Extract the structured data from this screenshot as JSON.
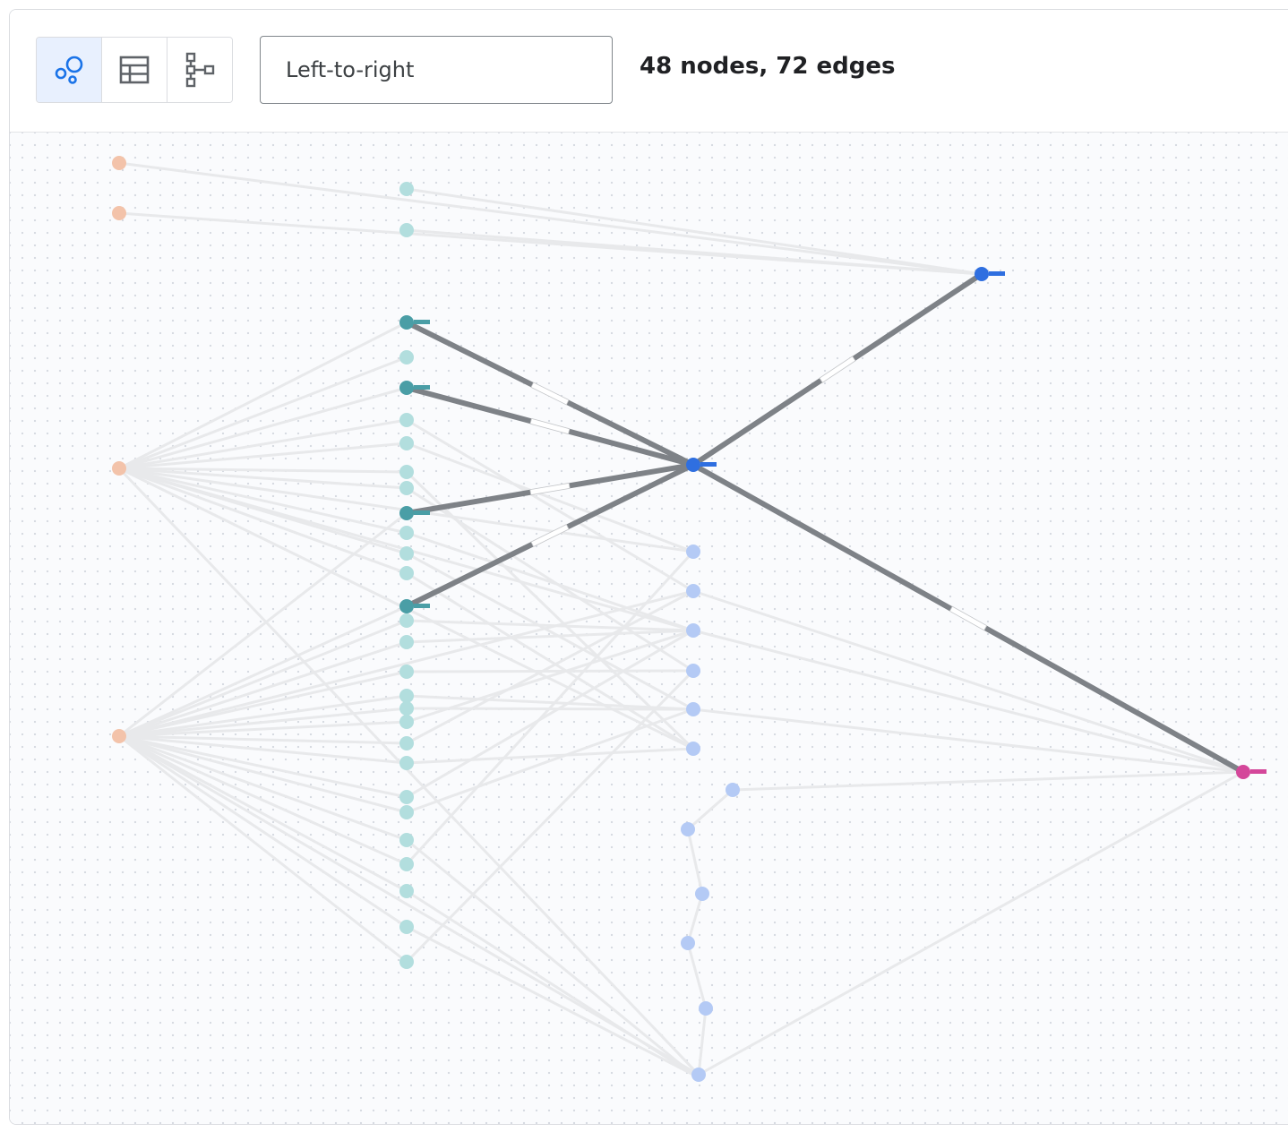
{
  "toolbar": {
    "view_buttons": [
      {
        "icon": "graph-view-icon",
        "active": true
      },
      {
        "icon": "table-view-icon",
        "active": false
      },
      {
        "icon": "hierarchy-view-icon",
        "active": false
      }
    ],
    "layout_select": {
      "value": "Left-to-right"
    },
    "summary": "48 nodes, 72 edges"
  },
  "graph": {
    "colors": {
      "source": "#f3c3aa",
      "material": "#b2dede",
      "material_selected": "#4a9ea6",
      "product": "#b4caf5",
      "product_selected": "#2f6fe0",
      "sink": "#d4479a",
      "edge": "#e8e9eb",
      "edge_highlight": "#7e8287"
    },
    "node_groups": [
      {
        "group": "source",
        "count": 4
      },
      {
        "group": "material",
        "count": 32,
        "highlighted": 4
      },
      {
        "group": "product",
        "count": 11,
        "highlighted": 1
      },
      {
        "group": "sink",
        "count": 1
      }
    ],
    "highlighted_edges": 6,
    "total_edges": 72
  }
}
